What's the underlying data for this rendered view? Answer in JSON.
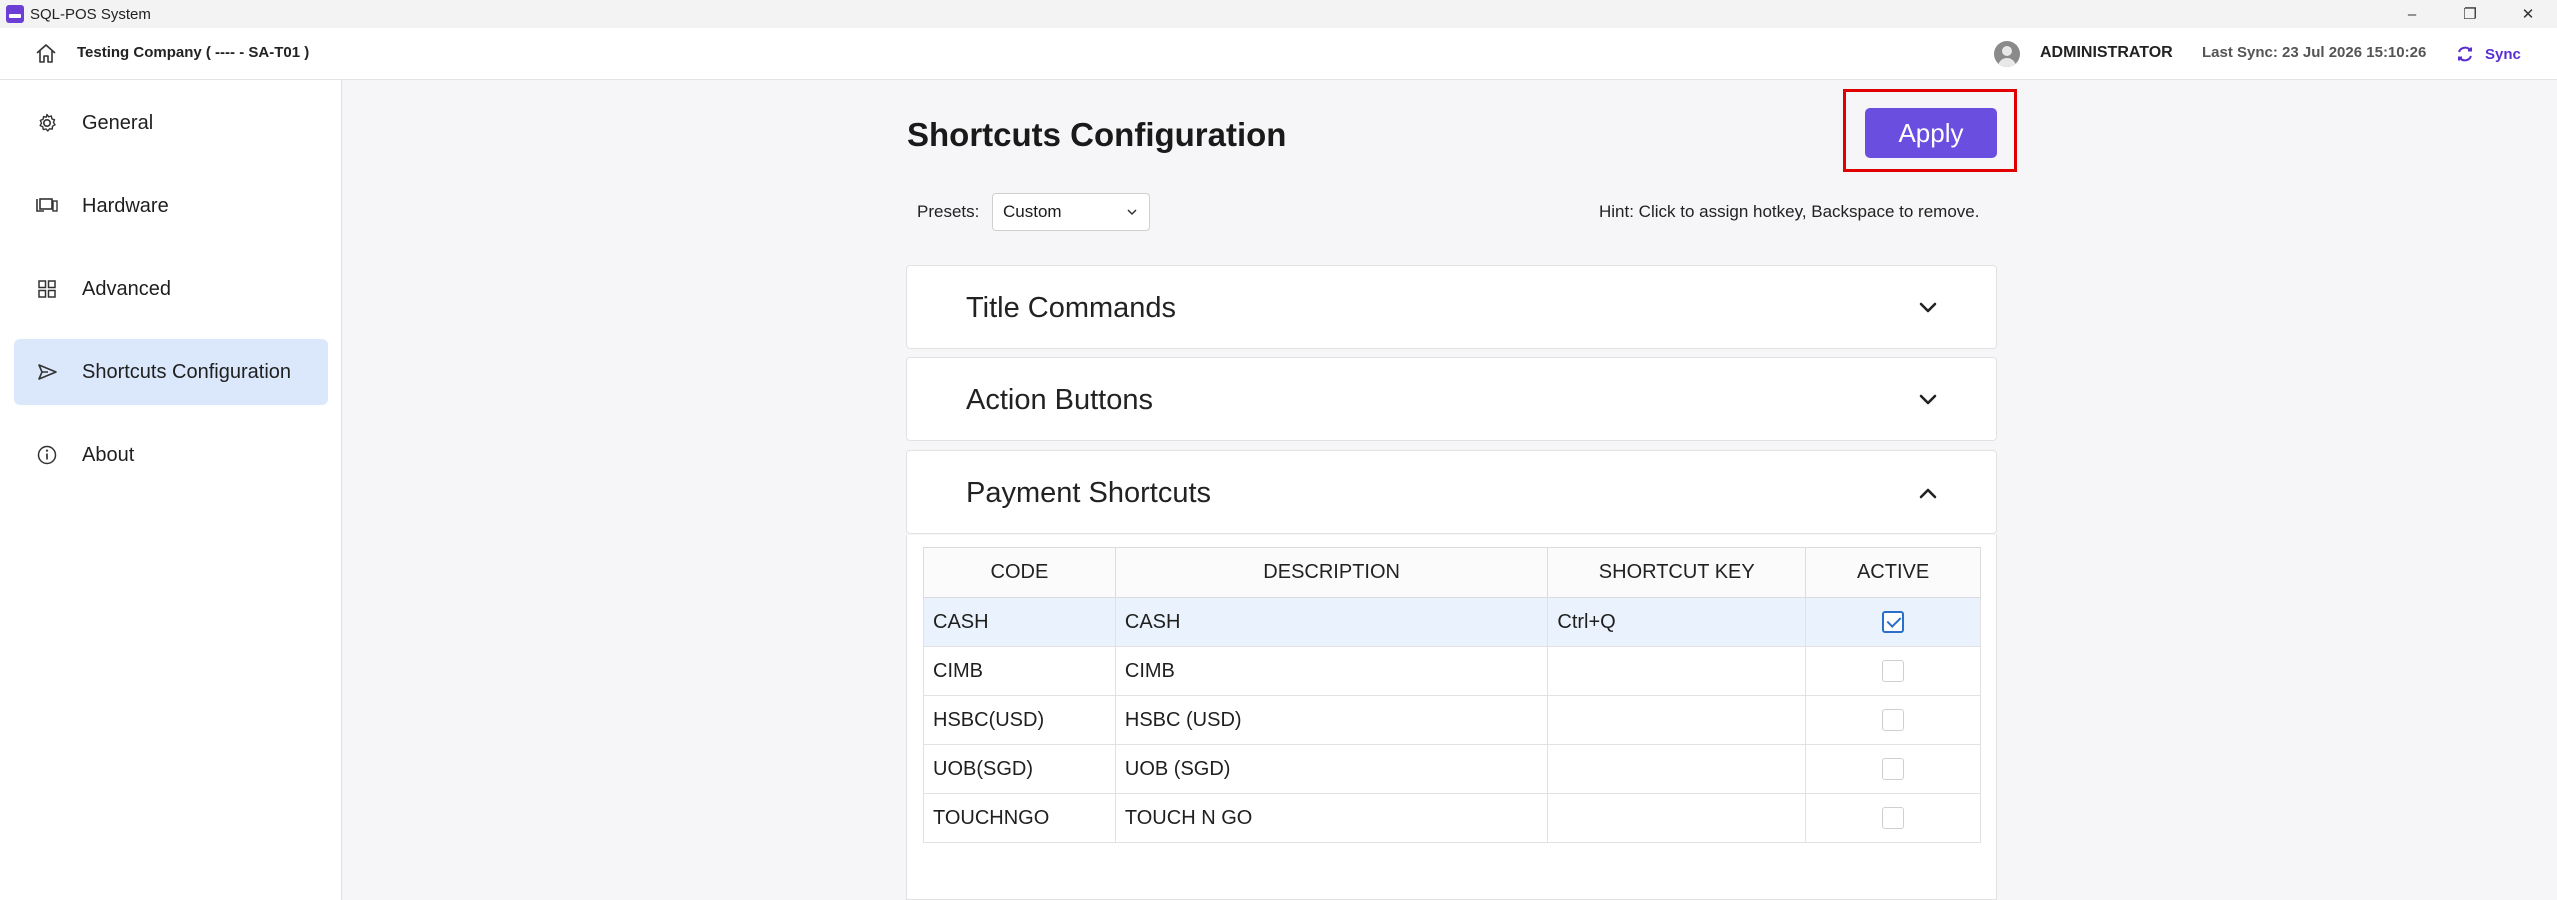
{
  "window": {
    "title": "SQL-POS System",
    "controls": [
      "–",
      "❐",
      "✕"
    ]
  },
  "header": {
    "company": "Testing Company ( ---- - SA-T01 )",
    "user": "ADMINISTRATOR",
    "last_sync": "Last Sync: 23 Jul 2026 15:10:26",
    "sync_label": "Sync"
  },
  "sidebar": {
    "items": [
      {
        "label": "General",
        "icon": "gear-icon"
      },
      {
        "label": "Hardware",
        "icon": "hardware-icon"
      },
      {
        "label": "Advanced",
        "icon": "grid-icon"
      },
      {
        "label": "Shortcuts Configuration",
        "icon": "send-icon",
        "active": true
      },
      {
        "label": "About",
        "icon": "info-icon"
      }
    ]
  },
  "main": {
    "title": "Shortcuts Configuration",
    "apply_label": "Apply",
    "presets_label": "Presets:",
    "presets_value": "Custom",
    "hint": "Hint: Click to assign hotkey, Backspace to remove.",
    "sections": [
      {
        "title": "Title Commands",
        "expanded": false
      },
      {
        "title": "Action Buttons",
        "expanded": false
      },
      {
        "title": "Payment Shortcuts",
        "expanded": true
      }
    ],
    "table": {
      "columns": [
        "CODE",
        "DESCRIPTION",
        "SHORTCUT KEY",
        "ACTIVE"
      ],
      "rows": [
        {
          "code": "CASH",
          "description": "CASH",
          "shortcut": "Ctrl+Q",
          "active": true
        },
        {
          "code": "CIMB",
          "description": "CIMB",
          "shortcut": "",
          "active": false
        },
        {
          "code": "HSBC(USD)",
          "description": "HSBC (USD)",
          "shortcut": "",
          "active": false
        },
        {
          "code": "UOB(SGD)",
          "description": "UOB (SGD)",
          "shortcut": "",
          "active": false
        },
        {
          "code": "TOUCHNGO",
          "description": "TOUCH N GO",
          "shortcut": "",
          "active": false
        }
      ]
    }
  },
  "colors": {
    "accent": "#6a4ee0",
    "sync": "#5a2fd0",
    "active_nav": "#dbe8fb",
    "highlight_frame": "#e00000"
  }
}
